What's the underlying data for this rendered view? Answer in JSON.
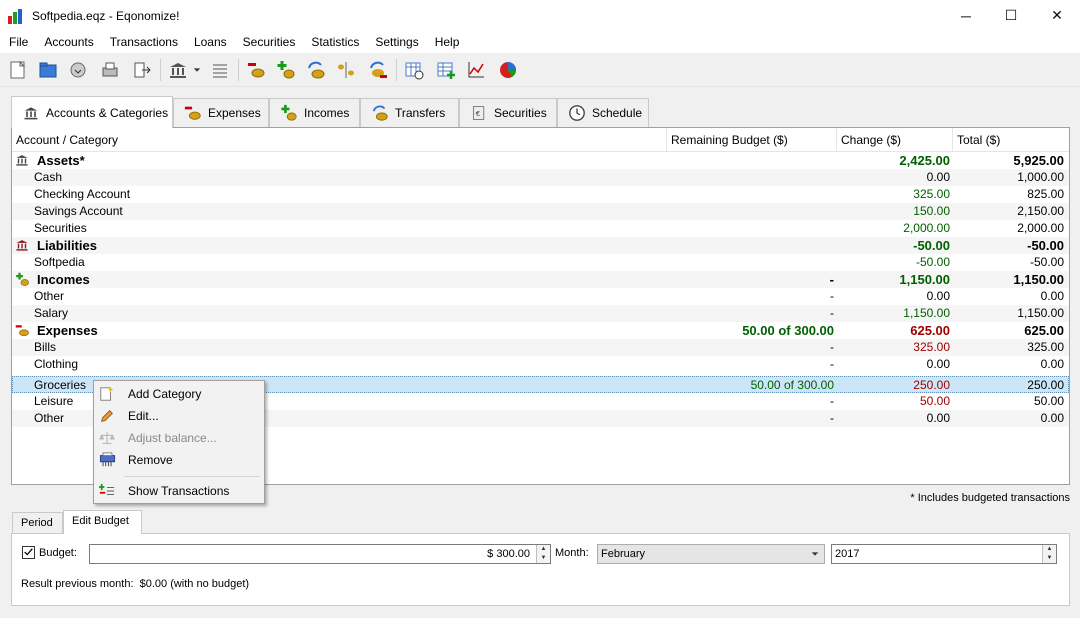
{
  "window": {
    "title": "Softpedia.eqz - Eqonomize!",
    "minimize": "─",
    "maximize": "☐",
    "close": "✕"
  },
  "menu": [
    "File",
    "Accounts",
    "Transactions",
    "Loans",
    "Securities",
    "Statistics",
    "Settings",
    "Help"
  ],
  "toolbar": {
    "buttons": [
      "new-file-icon",
      "open-file-icon",
      "save-file-icon",
      "print-icon",
      "exit-icon",
      "bank-icon",
      "dropdown-arrow-icon",
      "balance-icon",
      "new-expense-icon",
      "new-income-icon",
      "new-transfer-icon",
      "split-icon",
      "edit-icon",
      "schedule-icon",
      "table-icon",
      "line-chart-icon",
      "pie-chart-icon"
    ]
  },
  "tabs": [
    "Accounts & Categories",
    "Expenses",
    "Incomes",
    "Transfers",
    "Securities",
    "Schedule"
  ],
  "table": {
    "columns": [
      "Account / Category",
      "Remaining Budget ($)",
      "Change ($)",
      "Total ($)"
    ],
    "rows": [
      {
        "name": "Assets*",
        "rb": "",
        "ch": "2,425.00",
        "tot": "5,925.00"
      },
      {
        "name": "Cash",
        "rb": "",
        "ch": "0.00",
        "tot": "1,000.00"
      },
      {
        "name": "Checking Account",
        "rb": "",
        "ch": "325.00",
        "tot": "825.00"
      },
      {
        "name": "Savings Account",
        "rb": "",
        "ch": "150.00",
        "tot": "2,150.00"
      },
      {
        "name": "Securities",
        "rb": "",
        "ch": "2,000.00",
        "tot": "2,000.00"
      },
      {
        "name": "Liabilities",
        "rb": "",
        "ch": "-50.00",
        "tot": "-50.00"
      },
      {
        "name": "Softpedia",
        "rb": "",
        "ch": "-50.00",
        "tot": "-50.00"
      },
      {
        "name": "Incomes",
        "rb": "-",
        "ch": "1,150.00",
        "tot": "1,150.00"
      },
      {
        "name": "Other",
        "rb": "-",
        "ch": "0.00",
        "tot": "0.00"
      },
      {
        "name": "Salary",
        "rb": "-",
        "ch": "1,150.00",
        "tot": "1,150.00"
      },
      {
        "name": "Expenses",
        "rb": "50.00 of 300.00",
        "ch": "625.00",
        "tot": "625.00"
      },
      {
        "name": "Bills",
        "rb": "-",
        "ch": "325.00",
        "tot": "325.00"
      },
      {
        "name": "Clothing",
        "rb": "-",
        "ch": "0.00",
        "tot": "0.00"
      },
      {
        "name": "Groceries",
        "rb": "50.00 of 300.00",
        "ch": "250.00",
        "tot": "250.00"
      },
      {
        "name": "Leisure",
        "rb": "-",
        "ch": "50.00",
        "tot": "50.00"
      },
      {
        "name": "Other",
        "rb": "-",
        "ch": "0.00",
        "tot": "0.00"
      }
    ]
  },
  "context_menu": {
    "add_category": "Add Category",
    "edit": "Edit...",
    "adjust_balance": "Adjust balance...",
    "remove": "Remove",
    "show_transactions": "Show Transactions"
  },
  "note": "* Includes budgeted transactions",
  "bottom_tabs": [
    "Period",
    "Edit Budget"
  ],
  "budget": {
    "label": "Budget:",
    "value": "$ 300.00",
    "month_label": "Month:",
    "month": "February",
    "year": "2017",
    "result": "Result previous month:  $0.00 (with no budget)"
  },
  "colors": {
    "positive": "#006000",
    "negative": "#a00000",
    "selection": "#cde6f7"
  }
}
